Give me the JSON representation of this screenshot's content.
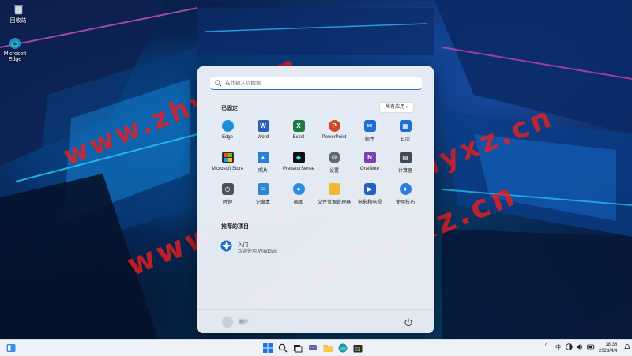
{
  "desktop": {
    "icons": [
      {
        "label": "回收站"
      },
      {
        "label": "Microsoft Edge"
      }
    ],
    "watermarks": [
      "www.zhyxz.cn",
      "www.zhyxz.cn",
      "www.zhyxz.cn",
      "zhyxz.cn"
    ]
  },
  "start_menu": {
    "search_placeholder": "在此键入以搜索",
    "pinned_title": "已固定",
    "all_apps_label": "所有应用 ›",
    "apps": [
      {
        "label": "Edge",
        "icon": "edge-icon",
        "color": "#1a8fd6"
      },
      {
        "label": "Word",
        "icon": "word-icon",
        "color": "#2b5fb8"
      },
      {
        "label": "Excel",
        "icon": "excel-icon",
        "color": "#1e7a45"
      },
      {
        "label": "PowerPoint",
        "icon": "powerpoint-icon",
        "color": "#d04a26"
      },
      {
        "label": "邮件",
        "icon": "mail-icon",
        "color": "#1d6fd0"
      },
      {
        "label": "日历",
        "icon": "calendar-icon",
        "color": "#1d6fd0"
      },
      {
        "label": "Microsoft Store",
        "icon": "store-icon",
        "color": "#2d2d2d"
      },
      {
        "label": "照片",
        "icon": "photos-icon",
        "color": "#2a7fd8"
      },
      {
        "label": "PredatorSense",
        "icon": "predatorsense-icon",
        "color": "#111111"
      },
      {
        "label": "设置",
        "icon": "settings-icon",
        "color": "#5c6b7a"
      },
      {
        "label": "OneNote",
        "icon": "onenote-icon",
        "color": "#7b3fb5"
      },
      {
        "label": "计算器",
        "icon": "calculator-icon",
        "color": "#3d4a58"
      },
      {
        "label": "时钟",
        "icon": "clock-icon",
        "color": "#4a5260"
      },
      {
        "label": "记事本",
        "icon": "notepad-icon",
        "color": "#2f86d6"
      },
      {
        "label": "画图",
        "icon": "paint-icon",
        "color": "#2c8de0"
      },
      {
        "label": "文件资源管理器",
        "icon": "folder-icon",
        "color": "#f2b735"
      },
      {
        "label": "电影和电视",
        "icon": "movies-icon",
        "color": "#2360c2"
      },
      {
        "label": "使用技巧",
        "icon": "tips-icon",
        "color": "#2b7de0"
      }
    ],
    "recommended_title": "推荐的项目",
    "recommended": [
      {
        "title": "入门",
        "subtitle": "欢迎使用 Windows"
      }
    ],
    "user_name": "用户",
    "power_label": "电源"
  },
  "taskbar": {
    "tray": {
      "chevron": "^",
      "ime": "中",
      "clock_time": "18:36",
      "clock_date": "2023/4/4"
    }
  }
}
